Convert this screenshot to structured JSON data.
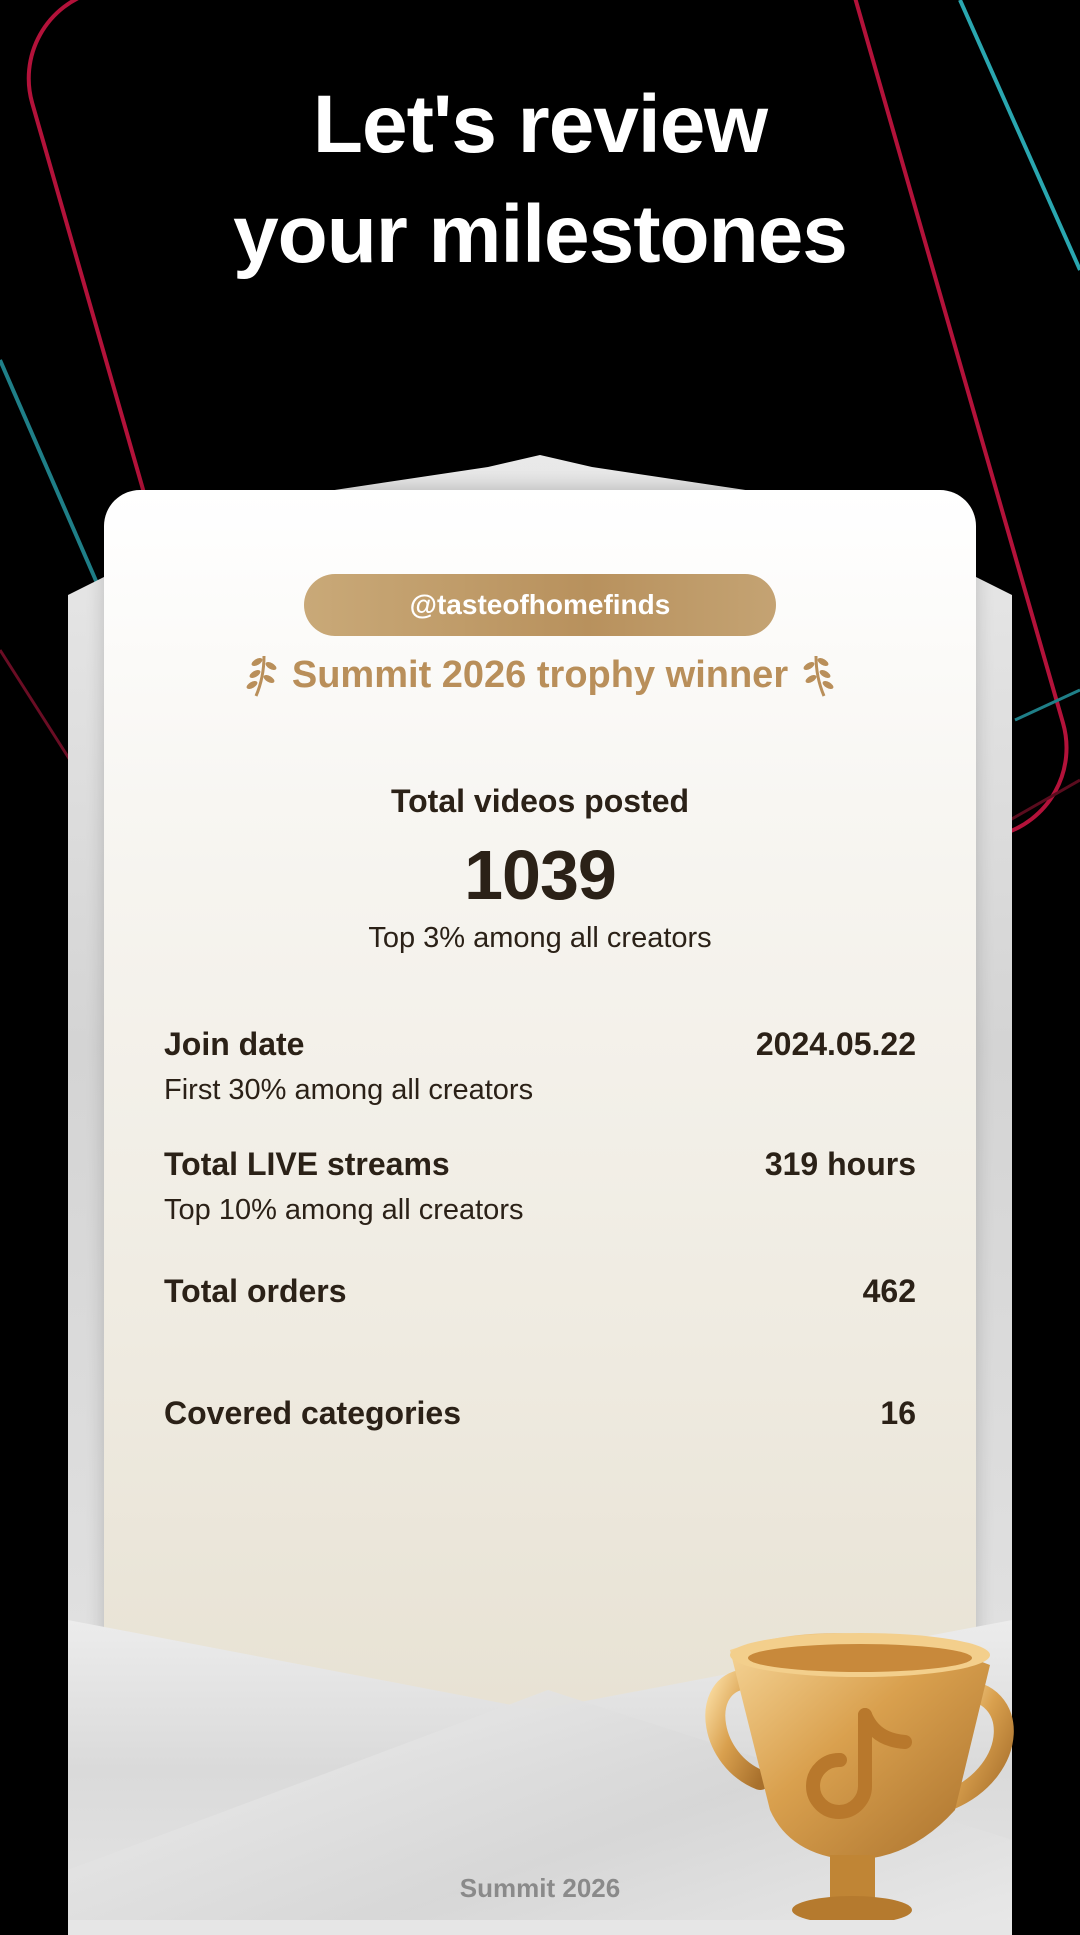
{
  "headline": {
    "line1": "Let's review",
    "line2": "your milestones"
  },
  "card": {
    "handle": "@tasteofhomefinds",
    "trophy_title": "Summit 2026 trophy winner",
    "main_stat": {
      "label": "Total videos posted",
      "value": "1039",
      "sub": "Top 3% among all creators"
    },
    "rows": [
      {
        "label": "Join date",
        "value": "2024.05.22",
        "sub": "First 30% among all creators"
      },
      {
        "label": "Total LIVE streams",
        "value": "319 hours",
        "sub": "Top 10% among all creators"
      },
      {
        "label": "Total orders",
        "value": "462",
        "sub": ""
      },
      {
        "label": "Covered categories",
        "value": "16",
        "sub": ""
      }
    ]
  },
  "footer": "Summit 2026",
  "icons": {
    "laurel": "laurel-icon",
    "trophy": "trophy-icon",
    "tiktok": "tiktok-logo-icon"
  },
  "colors": {
    "gold": "#b98f5a",
    "text_dark": "#2b2117",
    "background": "#000000"
  }
}
